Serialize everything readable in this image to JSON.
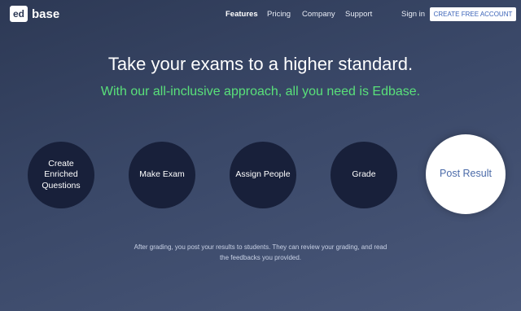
{
  "logo": {
    "mark": "ed",
    "name": "base"
  },
  "nav": {
    "items": [
      {
        "label": "Features",
        "active": true
      },
      {
        "label": "Pricing",
        "active": false
      },
      {
        "label": "Company",
        "active": false
      },
      {
        "label": "Support",
        "active": false
      }
    ],
    "signin": "Sign in",
    "cta": "CREATE FREE ACCOUNT"
  },
  "hero": {
    "headline": "Take your exams to a higher standard.",
    "subhead": "With our all-inclusive approach, all you need is Edbase."
  },
  "steps": [
    {
      "label": "Create\nEnriched\nQuestions",
      "active": false
    },
    {
      "label": "Make Exam",
      "active": false
    },
    {
      "label": "Assign People",
      "active": false
    },
    {
      "label": "Grade",
      "active": false
    },
    {
      "label": "Post Result",
      "active": true
    }
  ],
  "caption": "After grading, you post your results to students. They can review your grading, and read the feedbacks you provided.",
  "colors": {
    "background": "#2d3955",
    "accent_green": "#59e07a",
    "step_dark": "#18203a",
    "cta_text": "#3b63b8"
  }
}
